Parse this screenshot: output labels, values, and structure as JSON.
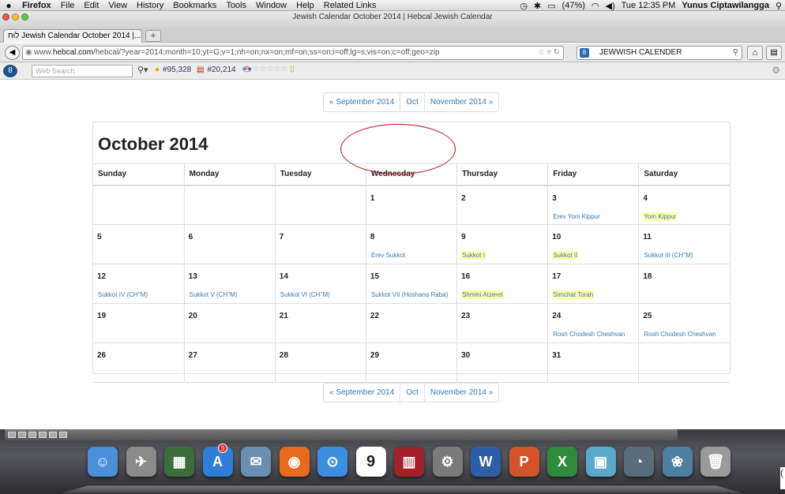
{
  "menubar": {
    "apple": "",
    "items": [
      "Firefox",
      "File",
      "Edit",
      "View",
      "History",
      "Bookmarks",
      "Tools",
      "Window",
      "Help",
      "Related Links"
    ],
    "battery": "(47%)",
    "clock": "Tue 12:35 PM",
    "user": "Yunus Ciptawilangga"
  },
  "window": {
    "title": "Jewish Calendar October 2014 | Hebcal Jewish Calendar"
  },
  "tab": {
    "label": "לוח Jewish Calendar October 2014 |...",
    "new_tab": "+"
  },
  "navbar": {
    "url_prefix": "www.",
    "url_host": "hebcal.com",
    "url_path": "/hebcal/?year=2014;month=10;yt=G;v=1;nh=on;nx=on;mf=on;ss=on;i=off;lg=s;vis=on;c=off;geo=zip",
    "search_value": "JEWWISH CALENDER",
    "search_engine_icon": "google-icon"
  },
  "toolbar": {
    "search_placeholder": "Web Search",
    "stat1": "#95,328",
    "stat2": "#20,214",
    "stars": "☆☆☆☆☆"
  },
  "pager": {
    "prev": "« September 2014",
    "current": "Oct",
    "next": "November 2014 »"
  },
  "calendar": {
    "title": "October 2014",
    "weekdays": [
      "Sunday",
      "Monday",
      "Tuesday",
      "Wednesday",
      "Thursday",
      "Friday",
      "Saturday"
    ],
    "weeks": [
      [
        {
          "d": "",
          "e": ""
        },
        {
          "d": "",
          "e": ""
        },
        {
          "d": "",
          "e": ""
        },
        {
          "d": "1",
          "e": ""
        },
        {
          "d": "2",
          "e": ""
        },
        {
          "d": "3",
          "e": "Erev Yom Kippur",
          "h": false
        },
        {
          "d": "4",
          "e": "Yom Kippur",
          "h": true
        }
      ],
      [
        {
          "d": "5",
          "e": ""
        },
        {
          "d": "6",
          "e": ""
        },
        {
          "d": "7",
          "e": ""
        },
        {
          "d": "8",
          "e": "Erev Sukkot",
          "h": false
        },
        {
          "d": "9",
          "e": "Sukkot I",
          "h": true
        },
        {
          "d": "10",
          "e": "Sukkot II",
          "h": true
        },
        {
          "d": "11",
          "e": "Sukkot III (CH''M)",
          "h": false
        }
      ],
      [
        {
          "d": "12",
          "e": "Sukkot IV (CH''M)",
          "h": false
        },
        {
          "d": "13",
          "e": "Sukkot V (CH''M)",
          "h": false
        },
        {
          "d": "14",
          "e": "Sukkot VI (CH''M)",
          "h": false
        },
        {
          "d": "15",
          "e": "Sukkot VII (Hoshana Raba)",
          "h": false
        },
        {
          "d": "16",
          "e": "Shmini Atzeret",
          "h": true
        },
        {
          "d": "17",
          "e": "Simchat Torah",
          "h": true
        },
        {
          "d": "18",
          "e": ""
        }
      ],
      [
        {
          "d": "19",
          "e": ""
        },
        {
          "d": "20",
          "e": ""
        },
        {
          "d": "21",
          "e": ""
        },
        {
          "d": "22",
          "e": ""
        },
        {
          "d": "23",
          "e": ""
        },
        {
          "d": "24",
          "e": "Rosh Chodesh Cheshvan",
          "h": false
        },
        {
          "d": "25",
          "e": "Rosh Chodesh Cheshvan",
          "h": false
        }
      ],
      [
        {
          "d": "26",
          "e": ""
        },
        {
          "d": "27",
          "e": ""
        },
        {
          "d": "28",
          "e": ""
        },
        {
          "d": "29",
          "e": ""
        },
        {
          "d": "30",
          "e": ""
        },
        {
          "d": "31",
          "e": ""
        },
        {
          "d": "",
          "e": ""
        }
      ]
    ]
  },
  "dock": {
    "badge": "3",
    "calendar_day": "9",
    "apps": [
      {
        "name": "finder-icon",
        "glyph": "☺",
        "color": "#4a90d9"
      },
      {
        "name": "launchpad-icon",
        "glyph": "✈",
        "color": "#8a8a8a"
      },
      {
        "name": "mission-control-icon",
        "glyph": "▦",
        "color": "#3b6e3b"
      },
      {
        "name": "app-store-icon",
        "glyph": "A",
        "color": "#2f7fd8"
      },
      {
        "name": "mail-icon",
        "glyph": "✉",
        "color": "#6b8fb0"
      },
      {
        "name": "firefox-icon",
        "glyph": "◉",
        "color": "#e66b1e"
      },
      {
        "name": "safari-icon",
        "glyph": "⊙",
        "color": "#3d8ee0"
      },
      {
        "name": "calendar-icon",
        "glyph": "9",
        "color": "#ffffff"
      },
      {
        "name": "photo-booth-icon",
        "glyph": "▥",
        "color": "#a3222a"
      },
      {
        "name": "system-preferences-icon",
        "glyph": "⚙",
        "color": "#7a7a7a"
      },
      {
        "name": "word-icon",
        "glyph": "W",
        "color": "#2f5ea8"
      },
      {
        "name": "powerpoint-icon",
        "glyph": "P",
        "color": "#d4532a"
      },
      {
        "name": "excel-icon",
        "glyph": "X",
        "color": "#2e8b3c"
      },
      {
        "name": "preview-icon",
        "glyph": "▣",
        "color": "#5aa9c9"
      },
      {
        "name": "time-machine-icon",
        "glyph": "◔",
        "color": "#5a6b7a"
      },
      {
        "name": "iphoto-icon",
        "glyph": "❀",
        "color": "#4e7fa3"
      },
      {
        "name": "trash-icon",
        "glyph": "🗑",
        "color": "#9a9a9a"
      }
    ]
  },
  "colors": {
    "link": "#337ab7",
    "highlight": "#ffffa8",
    "annotation": "#c1121f"
  }
}
